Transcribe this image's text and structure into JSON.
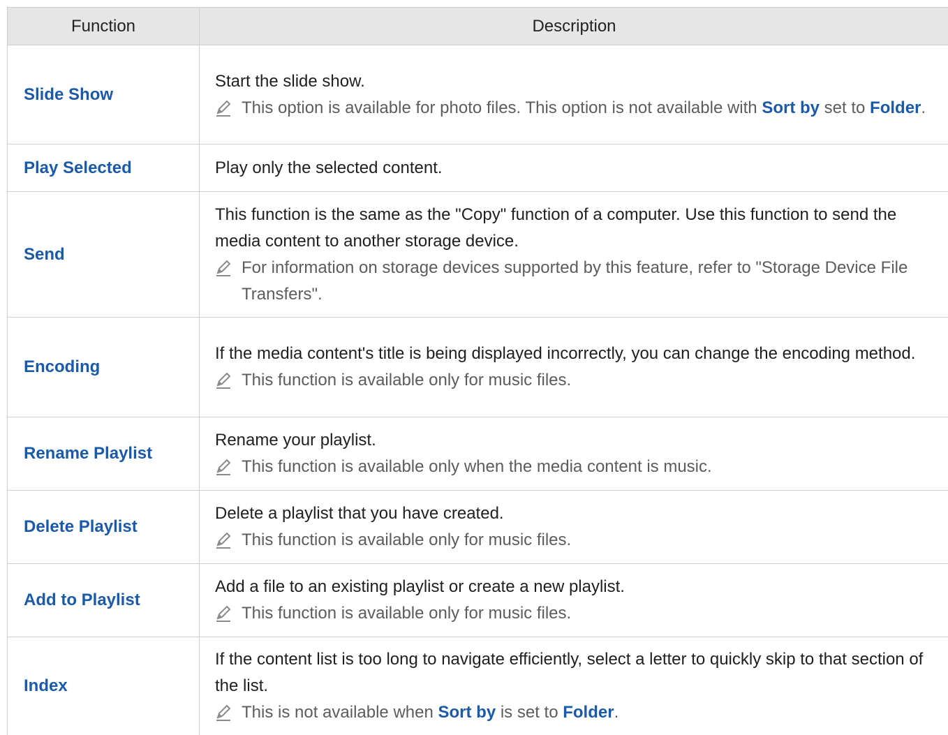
{
  "header": {
    "function_col": "Function",
    "description_col": "Description"
  },
  "rows": [
    {
      "function": "Slide Show",
      "main": "Start the slide show.",
      "note": {
        "parts": [
          "This option is available for photo files. This option is not available with ",
          "Sort by",
          " set to ",
          "Folder",
          "."
        ]
      }
    },
    {
      "function": "Play Selected",
      "main": "Play only the selected content."
    },
    {
      "function": "Send",
      "main": "This function is the same as the \"Copy\" function of a computer. Use this function to send the media content to another storage device.",
      "note": {
        "parts": [
          "For information on storage devices supported by this feature, refer to \"Storage Device File Transfers\"."
        ]
      }
    },
    {
      "function": "Encoding",
      "main": "If the media content's title is being displayed incorrectly, you can change the encoding method.",
      "note": {
        "parts": [
          "This function is available only for music files."
        ]
      }
    },
    {
      "function": "Rename Playlist",
      "main": "Rename your playlist.",
      "note": {
        "parts": [
          "This function is available only when the media content is music."
        ]
      }
    },
    {
      "function": "Delete Playlist",
      "main": "Delete a playlist that you have created.",
      "note": {
        "parts": [
          "This function is available only for music files."
        ]
      }
    },
    {
      "function": "Add to Playlist",
      "main": "Add a file to an existing playlist or create a new playlist.",
      "note": {
        "parts": [
          "This function is available only for music files."
        ]
      }
    },
    {
      "function": "Index",
      "main": "If the content list is too long to navigate efficiently, select a letter to quickly skip to that section of the list.",
      "note": {
        "parts": [
          "This is not available when ",
          "Sort by",
          " is set to ",
          "Folder",
          "."
        ]
      }
    }
  ],
  "colors": {
    "accent": "#1a5aa8",
    "header_bg": "#e6e6e6",
    "note_text": "#5c5c5c"
  },
  "icons": {
    "note": "pencil-icon"
  }
}
